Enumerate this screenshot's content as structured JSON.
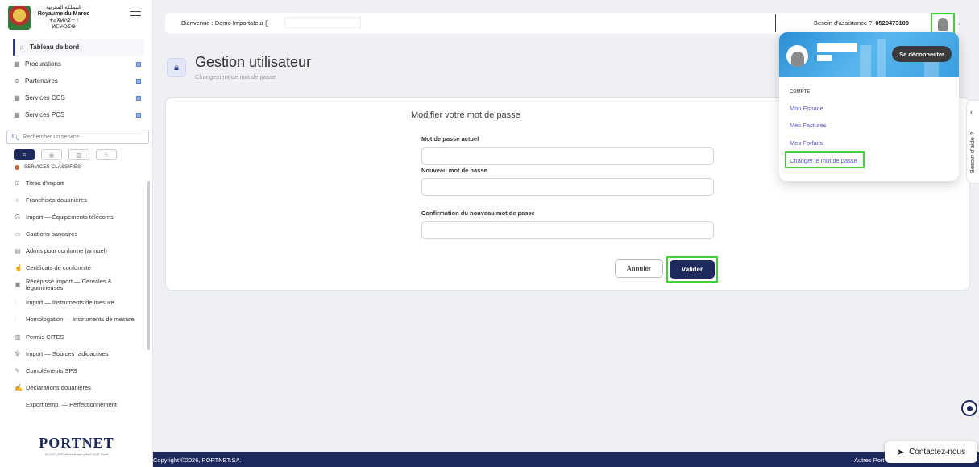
{
  "sidebar": {
    "logo": {
      "line1": "المملكة المغربية",
      "line2": "Royaume du Maroc",
      "line3": "ⵜⴰⴳⵍⴷⵉⵜ ⵏ ⵍⵎⵖⵔⵉⴱ"
    },
    "nav": [
      {
        "label": "Tableau de bord",
        "icon": "home-icon",
        "glyph": "⌂"
      },
      {
        "label": "Procurations",
        "icon": "grid-icon",
        "glyph": "▦"
      },
      {
        "label": "Partenaires",
        "icon": "globe-icon",
        "glyph": "⊕"
      },
      {
        "label": "Services CCS",
        "icon": "grid-icon",
        "glyph": "▦"
      },
      {
        "label": "Services PCS",
        "icon": "grid-icon",
        "glyph": "▦"
      }
    ],
    "search_placeholder": "Rechercher un service...",
    "filters": [
      "≡",
      "◉",
      "▥",
      "ϟ"
    ],
    "section_title": "SERVICES CLASSIFIÉS",
    "services": [
      {
        "label": "Titres d'import",
        "glyph": "⊡"
      },
      {
        "label": "Franchises douanières",
        "glyph": "♁"
      },
      {
        "label": "Import — Équipements télécoms",
        "glyph": "☊"
      },
      {
        "label": "Cautions bancaires",
        "glyph": "▭"
      },
      {
        "label": "Admis pour conforme (annuel)",
        "glyph": "▤"
      },
      {
        "label": "Certificats de conformité",
        "glyph": "☝"
      },
      {
        "label": "Récépissé import — Céréales & légumineuses",
        "glyph": "▣"
      },
      {
        "label": "Import — Instruments de mesure",
        "glyph": "⫶"
      },
      {
        "label": "Homologation — Instruments de mesure",
        "glyph": "⫶"
      },
      {
        "label": "Permis CITES",
        "glyph": "▥"
      },
      {
        "label": "Import — Sources radioactives",
        "glyph": "☢"
      },
      {
        "label": "Compléments SPS",
        "glyph": "✎"
      },
      {
        "label": "Déclarations douanières",
        "glyph": "✍"
      },
      {
        "label": "Export temp. — Perfectionnement",
        "glyph": ""
      }
    ],
    "brand": "PORTNET",
    "brand_sub": "الشباك الوحيد الوطني لتبسيط مساطر التجارة الخارجية"
  },
  "topbar": {
    "welcome": "Bienvenue : Demo Importateur []",
    "assist_label": "Besoin d'assistance ?",
    "assist_phone": "0520473100"
  },
  "page": {
    "title": "Gestion utilisateur",
    "subtitle": "Changement de mot de passe"
  },
  "form": {
    "title": "Modifier votre mot de passe",
    "current_label": "Mot de passe actuel",
    "new_label": "Nouveau mot de passe",
    "confirm_label": "Confirmation du nouveau mot de passe",
    "cancel": "Annuler",
    "submit": "Valider"
  },
  "dropdown": {
    "logout": "Se déconnecter",
    "section": "COMPTE",
    "links": [
      "Mon Espace",
      "Mes Factures",
      "Mes Forfaits",
      "Changer le mot de passe"
    ]
  },
  "help_tab": "Besoin d'aide ?",
  "footer": {
    "copyright": "Copyright ©2026, PORTNET.SA.",
    "others": "Autres Port"
  },
  "contact": "Contactez-nous",
  "colors": {
    "navy": "#1e2a5e",
    "highlight": "#43d13a",
    "link": "#5a54c9"
  }
}
